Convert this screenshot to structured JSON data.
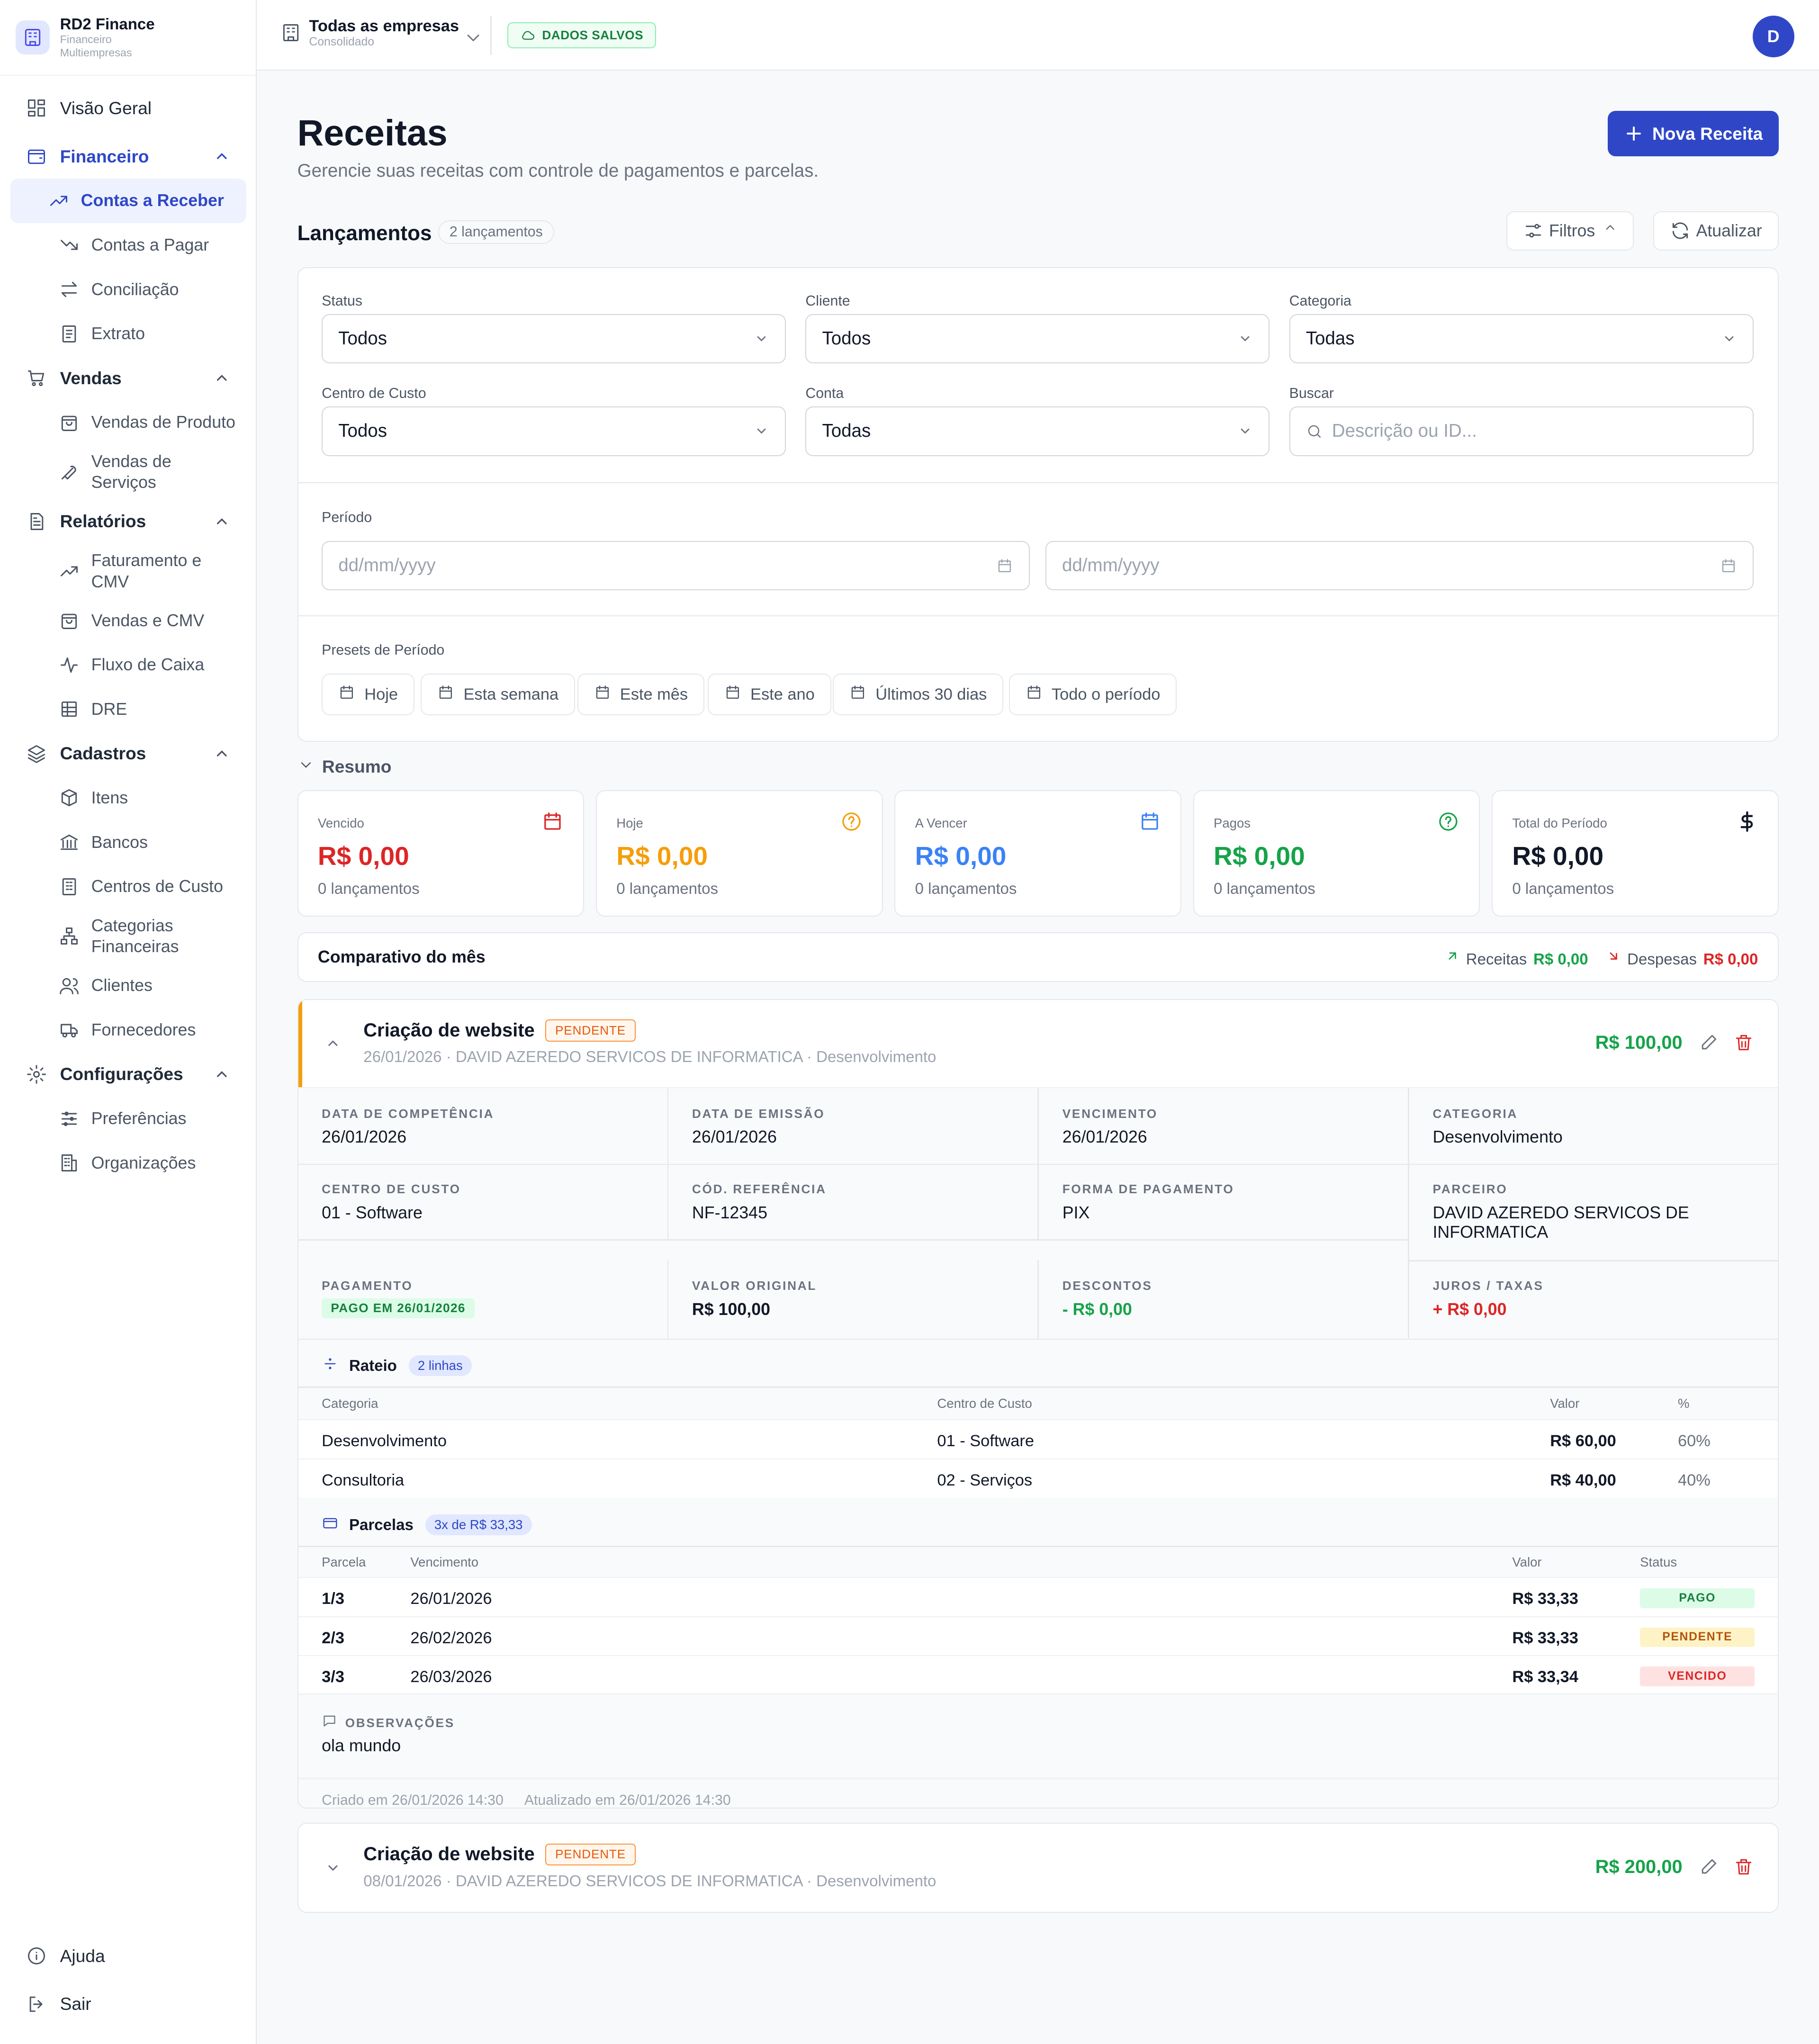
{
  "brand": {
    "name": "RD2 Finance",
    "subtitle": "Financeiro Multiempresas"
  },
  "nav": {
    "overview": "Visão Geral",
    "financeiro": "Financeiro",
    "contas_receber": "Contas a Receber",
    "contas_pagar": "Contas a Pagar",
    "conciliacao": "Conciliação",
    "extrato": "Extrato",
    "vendas": "Vendas",
    "vendas_produto": "Vendas de Produto",
    "vendas_servicos": "Vendas de Serviços",
    "relatorios": "Relatórios",
    "faturamento": "Faturamento e CMV",
    "vendas_cmv": "Vendas e CMV",
    "fluxo": "Fluxo de Caixa",
    "dre": "DRE",
    "cadastros": "Cadastros",
    "itens": "Itens",
    "bancos": "Bancos",
    "centros": "Centros de Custo",
    "categorias": "Categorias Financeiras",
    "clientes": "Clientes",
    "fornecedores": "Fornecedores",
    "configuracoes": "Configurações",
    "preferencias": "Preferências",
    "organizacoes": "Organizações",
    "ajuda": "Ajuda",
    "sair": "Sair"
  },
  "topbar": {
    "company": "Todas as empresas",
    "company_sub": "Consolidado",
    "saved": "DADOS SALVOS",
    "avatar": "D"
  },
  "page": {
    "title": "Receitas",
    "subtitle": "Gerencie suas receitas com controle de pagamentos e parcelas.",
    "new_button": "Nova Receita"
  },
  "list": {
    "title": "Lançamentos",
    "count": "2 lançamentos",
    "filters_btn": "Filtros",
    "refresh_btn": "Atualizar"
  },
  "filters": {
    "status_label": "Status",
    "status_value": "Todos",
    "cliente_label": "Cliente",
    "cliente_value": "Todos",
    "categoria_label": "Categoria",
    "categoria_value": "Todas",
    "centro_label": "Centro de Custo",
    "centro_value": "Todos",
    "conta_label": "Conta",
    "conta_value": "Todas",
    "buscar_label": "Buscar",
    "buscar_placeholder": "Descrição ou ID...",
    "periodo_label": "Período",
    "date_placeholder": "dd/mm/yyyy",
    "presets_label": "Presets de Período",
    "presets": [
      "Hoje",
      "Esta semana",
      "Este mês",
      "Este ano",
      "Últimos 30 dias",
      "Todo o período"
    ]
  },
  "resumo": {
    "title": "Resumo",
    "cards": [
      {
        "label": "Vencido",
        "value": "R$ 0,00",
        "count": "0 lançamentos",
        "color": "#dc2626",
        "icon": "calendar-icon"
      },
      {
        "label": "Hoje",
        "value": "R$ 0,00",
        "count": "0 lançamentos",
        "color": "#f59e0b",
        "icon": "help-circle-icon"
      },
      {
        "label": "A Vencer",
        "value": "R$ 0,00",
        "count": "0 lançamentos",
        "color": "#3b82f6",
        "icon": "calendar-icon"
      },
      {
        "label": "Pagos",
        "value": "R$ 0,00",
        "count": "0 lançamentos",
        "color": "#16a34a",
        "icon": "help-circle-icon"
      },
      {
        "label": "Total do Período",
        "value": "R$ 0,00",
        "count": "0 lançamentos",
        "color": "#111827",
        "icon": "dollar-icon"
      }
    ]
  },
  "comparativo": {
    "title": "Comparativo do mês",
    "receitas_label": "Receitas",
    "receitas_value": "R$ 0,00",
    "despesas_label": "Despesas",
    "despesas_value": "R$ 0,00"
  },
  "entries": [
    {
      "title": "Criação de website",
      "status": "PENDENTE",
      "date": "26/01/2026",
      "partner": "DAVID AZEREDO SERVICOS DE INFORMATICA",
      "category": "Desenvolvimento",
      "amount": "R$ 100,00",
      "details": {
        "competencia_k": "DATA DE COMPETÊNCIA",
        "competencia": "26/01/2026",
        "emissao_k": "DATA DE EMISSÃO",
        "emissao": "26/01/2026",
        "vencimento_k": "VENCIMENTO",
        "vencimento": "26/01/2026",
        "categoria_k": "CATEGORIA",
        "categoria": "Desenvolvimento",
        "centro_k": "CENTRO DE CUSTO",
        "centro": "01 - Software",
        "ref_k": "CÓD. REFERÊNCIA",
        "ref": "NF-12345",
        "forma_k": "FORMA DE PAGAMENTO",
        "forma": "PIX",
        "parceiro_k": "PARCEIRO",
        "parceiro": "DAVID AZEREDO SERVICOS DE INFORMATICA",
        "pagamento_k": "PAGAMENTO",
        "pagamento": "PAGO EM 26/01/2026",
        "original_k": "VALOR ORIGINAL",
        "original": "R$ 100,00",
        "descontos_k": "DESCONTOS",
        "descontos": "- R$ 0,00",
        "juros_k": "JUROS / TAXAS",
        "juros": "+ R$ 0,00"
      },
      "rateio": {
        "title": "Rateio",
        "chip": "2 linhas",
        "headers": [
          "Categoria",
          "Centro de Custo",
          "Valor",
          "%"
        ],
        "rows": [
          [
            "Desenvolvimento",
            "01 - Software",
            "R$ 60,00",
            "60%"
          ],
          [
            "Consultoria",
            "02 - Serviços",
            "R$ 40,00",
            "40%"
          ]
        ]
      },
      "parcelas": {
        "title": "Parcelas",
        "chip": "3x de R$ 33,33",
        "headers": [
          "Parcela",
          "Vencimento",
          "Valor",
          "Status"
        ],
        "rows": [
          [
            "1/3",
            "26/01/2026",
            "R$ 33,33",
            "PAGO"
          ],
          [
            "2/3",
            "26/02/2026",
            "R$ 33,33",
            "PENDENTE"
          ],
          [
            "3/3",
            "26/03/2026",
            "R$ 33,34",
            "VENCIDO"
          ]
        ]
      },
      "obs_k": "OBSERVAÇÕES",
      "obs": "ola mundo",
      "created": "Criado em 26/01/2026 14:30",
      "updated": "Atualizado em 26/01/2026 14:30"
    },
    {
      "title": "Criação de website",
      "status": "PENDENTE",
      "date": "08/01/2026",
      "partner": "DAVID AZEREDO SERVICOS DE INFORMATICA",
      "category": "Desenvolvimento",
      "amount": "R$ 200,00"
    }
  ]
}
